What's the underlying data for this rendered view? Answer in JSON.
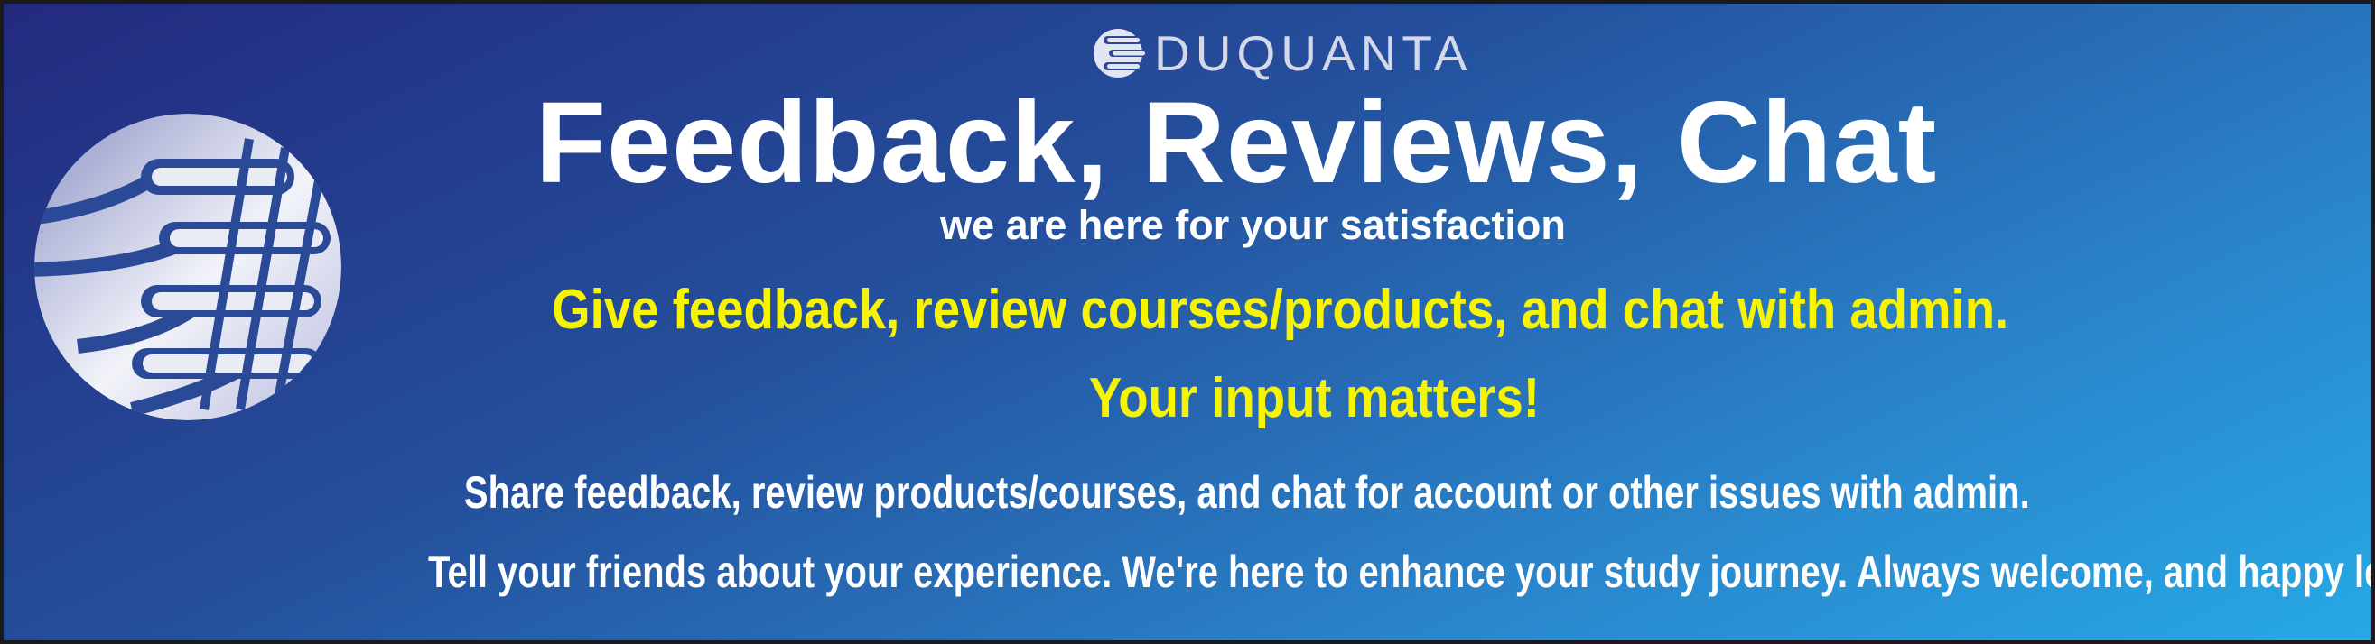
{
  "brand": {
    "logo_icon": "eduquanta-globe-e-icon",
    "name": "DUQUANTA"
  },
  "hero": {
    "title": "Feedback, Reviews, Chat",
    "subtitle": "we are here for your satisfaction",
    "highlight_line1": "Give feedback, review courses/products, and chat with admin.",
    "highlight_line2": "Your input matters!",
    "body_line1": "Share feedback, review products/courses, and chat for account or other issues with admin.",
    "body_line2": "Tell your friends about your experience. We're here to enhance your study journey. Always welcome, and happy learning!"
  },
  "colors": {
    "gradient_start": "#232a7e",
    "gradient_end": "#26a9e6",
    "title": "#ffffff",
    "highlight": "#f7f400",
    "logo_light": "#e6e8f3"
  }
}
